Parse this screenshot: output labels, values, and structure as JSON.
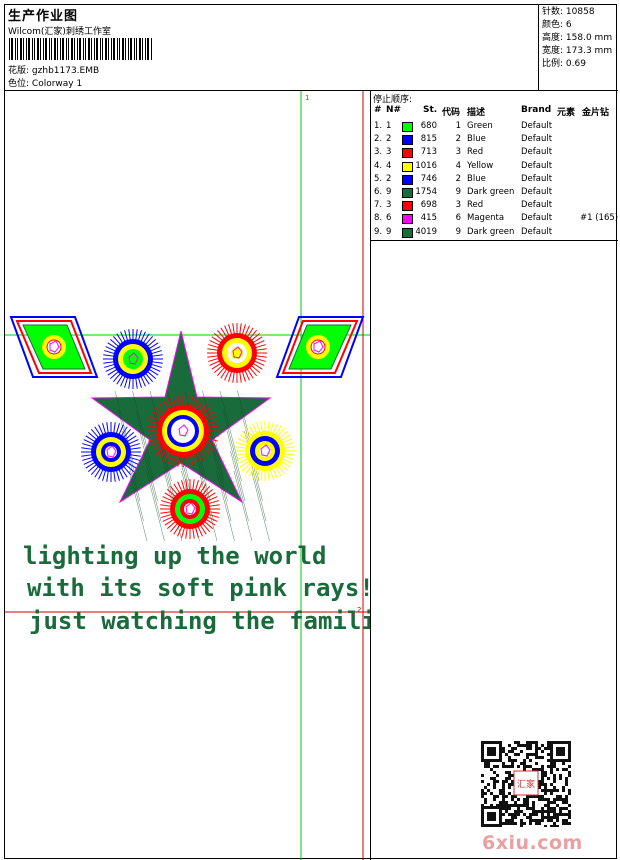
{
  "header": {
    "title": "生产作业图",
    "company": "Wilcom(汇家)刺绣工作室",
    "design_label": "花版:",
    "design_value": "gzhb1173.EMB",
    "colorway_label": "色位:",
    "colorway_value": "Colorway 1"
  },
  "stats": [
    {
      "label": "针数:",
      "value": "10858"
    },
    {
      "label": "颜色:",
      "value": "6"
    },
    {
      "label": "高度:",
      "value": "158.0 mm"
    },
    {
      "label": "宽度:",
      "value": "173.3 mm"
    },
    {
      "label": "比例:",
      "value": "0.69"
    }
  ],
  "stop_sequence": {
    "title": "停止顺序:",
    "headers": {
      "idx": "#",
      "no": "N#",
      "st": "St.",
      "code": "代码",
      "desc": "描述",
      "brand": "Brand",
      "elem": "元素",
      "sequin": "金片钻"
    },
    "rows": [
      {
        "idx": "1.",
        "no": "1",
        "swatch": "#00ff00",
        "st": "680",
        "code": "1",
        "desc": "Green",
        "brand": "Default",
        "elem": ""
      },
      {
        "idx": "2.",
        "no": "2",
        "swatch": "#0000ff",
        "st": "815",
        "code": "2",
        "desc": "Blue",
        "brand": "Default",
        "elem": ""
      },
      {
        "idx": "3.",
        "no": "3",
        "swatch": "#ff0000",
        "st": "713",
        "code": "3",
        "desc": "Red",
        "brand": "Default",
        "elem": ""
      },
      {
        "idx": "4.",
        "no": "4",
        "swatch": "#ffff00",
        "st": "1016",
        "code": "4",
        "desc": "Yellow",
        "brand": "Default",
        "elem": ""
      },
      {
        "idx": "5.",
        "no": "2",
        "swatch": "#0000ff",
        "st": "746",
        "code": "2",
        "desc": "Blue",
        "brand": "Default",
        "elem": ""
      },
      {
        "idx": "6.",
        "no": "9",
        "swatch": "#1a6b3c",
        "st": "1754",
        "code": "9",
        "desc": "Dark green",
        "brand": "Default",
        "elem": ""
      },
      {
        "idx": "7.",
        "no": "3",
        "swatch": "#ff0000",
        "st": "698",
        "code": "3",
        "desc": "Red",
        "brand": "Default",
        "elem": ""
      },
      {
        "idx": "8.",
        "no": "6",
        "swatch": "#ff00ff",
        "st": "415",
        "code": "6",
        "desc": "Magenta",
        "brand": "Default",
        "elem": "#1 (165)"
      },
      {
        "idx": "9.",
        "no": "9",
        "swatch": "#1a6b3c",
        "st": "4019",
        "code": "9",
        "desc": "Dark green",
        "brand": "Default",
        "elem": ""
      }
    ]
  },
  "design_area": {
    "text_lines": [
      "lighting up the world",
      "with its soft pink rays!",
      "just watching the familiar"
    ],
    "marker_1": "1",
    "marker_2": "2",
    "colors": {
      "green": "#00ff00",
      "blue": "#0000ff",
      "red": "#ff0000",
      "yellow": "#ffff00",
      "dark_green": "#1a6b3c",
      "magenta": "#ff00ff",
      "guide_green": "#00cc00",
      "guide_red": "#cc0000"
    }
  },
  "watermark": "6xiu.com",
  "qr_badge": "汇家"
}
